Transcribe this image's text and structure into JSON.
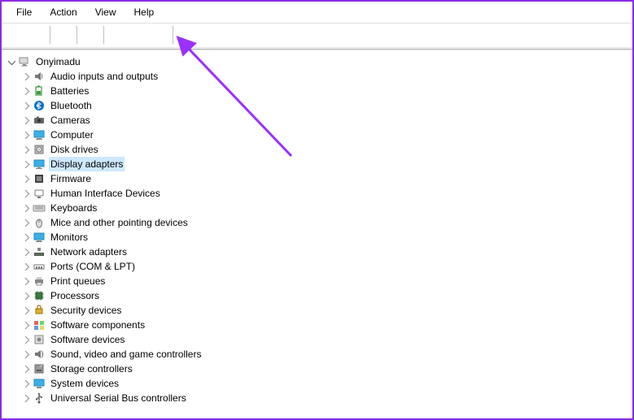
{
  "menu": {
    "file": "File",
    "action": "Action",
    "view": "View",
    "help": "Help"
  },
  "toolbar_icons": {
    "back": "back-arrow",
    "forward": "forward-arrow",
    "up": "show-connection",
    "details": "details",
    "help": "help",
    "action": "action-window",
    "update": "update-driver",
    "scan": "scan-hardware"
  },
  "root": {
    "label": "Onyimadu",
    "icon": "computer-root"
  },
  "categories": [
    {
      "label": "Audio inputs and outputs",
      "icon": "audio",
      "expanded": false
    },
    {
      "label": "Batteries",
      "icon": "battery",
      "expanded": false
    },
    {
      "label": "Bluetooth",
      "icon": "bluetooth",
      "expanded": false
    },
    {
      "label": "Cameras",
      "icon": "camera",
      "expanded": false
    },
    {
      "label": "Computer",
      "icon": "computer",
      "expanded": false
    },
    {
      "label": "Disk drives",
      "icon": "disk",
      "expanded": false
    },
    {
      "label": "Display adapters",
      "icon": "display",
      "expanded": false,
      "selected": true
    },
    {
      "label": "Firmware",
      "icon": "firmware",
      "expanded": false
    },
    {
      "label": "Human Interface Devices",
      "icon": "hid",
      "expanded": false
    },
    {
      "label": "Keyboards",
      "icon": "keyboard",
      "expanded": false
    },
    {
      "label": "Mice and other pointing devices",
      "icon": "mouse",
      "expanded": false
    },
    {
      "label": "Monitors",
      "icon": "monitor",
      "expanded": false
    },
    {
      "label": "Network adapters",
      "icon": "network",
      "expanded": false
    },
    {
      "label": "Ports (COM & LPT)",
      "icon": "port",
      "expanded": false
    },
    {
      "label": "Print queues",
      "icon": "printer",
      "expanded": false
    },
    {
      "label": "Processors",
      "icon": "cpu",
      "expanded": false
    },
    {
      "label": "Security devices",
      "icon": "security",
      "expanded": false
    },
    {
      "label": "Software components",
      "icon": "swcomp",
      "expanded": false
    },
    {
      "label": "Software devices",
      "icon": "swdev",
      "expanded": false
    },
    {
      "label": "Sound, video and game controllers",
      "icon": "sound",
      "expanded": false
    },
    {
      "label": "Storage controllers",
      "icon": "storage",
      "expanded": false
    },
    {
      "label": "System devices",
      "icon": "system",
      "expanded": false
    },
    {
      "label": "Universal Serial Bus controllers",
      "icon": "usb",
      "expanded": false
    }
  ],
  "annotation": {
    "arrow_color": "#9b30ff",
    "target": "scan-hardware-button"
  }
}
